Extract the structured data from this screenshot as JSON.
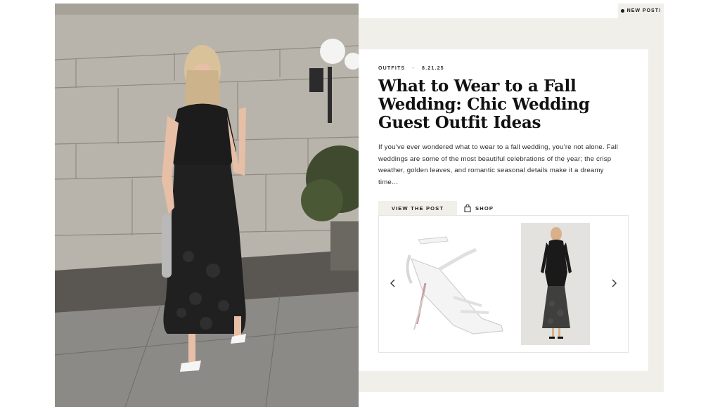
{
  "hero": {
    "alt_icon": "fall-wedding-outfit-photo"
  },
  "badge": {
    "label": "NEW POST!"
  },
  "post": {
    "category": "OUTFITS",
    "date": "8.21.25",
    "title": "What to Wear to a Fall Wedding: Chic Wedding Guest Outfit Ideas",
    "excerpt": "If you’ve ever wondered what to wear to a fall wedding, you’re not alone. Fall weddings are some of the most beautiful celebrations of the year; the crisp weather, golden leaves, and romantic seasonal details make it a dreamy time…"
  },
  "actions": {
    "view_label": "VIEW THE POST",
    "shop_label": "SHOP",
    "shop_icon": "shopping-bag-icon"
  },
  "carousel": {
    "prev_icon": "chevron-left-icon",
    "next_icon": "chevron-right-icon",
    "products": [
      {
        "icon": "white-strappy-heel-sandal"
      },
      {
        "icon": "black-lace-maxi-dress"
      }
    ]
  },
  "colors": {
    "cream": "#f1efe9",
    "text": "#1a1a1a",
    "card": "#ffffff"
  }
}
